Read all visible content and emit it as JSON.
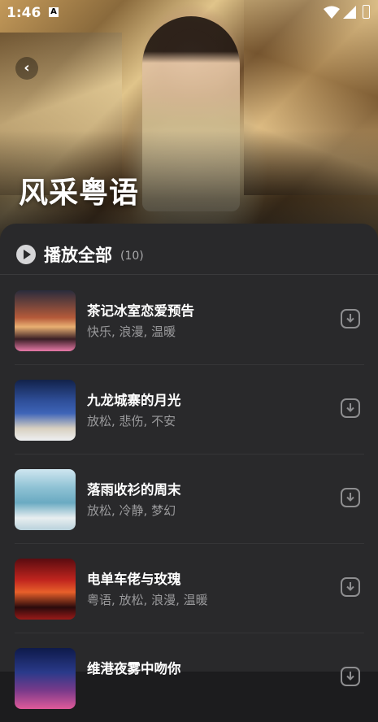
{
  "status_bar": {
    "time": "1:46",
    "notif_glyph": "A"
  },
  "header": {
    "title": "风采粤语",
    "back_icon": "chevron-left-icon"
  },
  "play_all": {
    "label": "播放全部",
    "count": "(10)"
  },
  "songs": [
    {
      "title": "茶记冰室恋爱预告",
      "tags": "快乐, 浪漫, 温暖"
    },
    {
      "title": "九龙城寨的月光",
      "tags": "放松, 悲伤, 不安"
    },
    {
      "title": "落雨收衫的周末",
      "tags": "放松, 冷静, 梦幻"
    },
    {
      "title": "电单车佬与玫瑰",
      "tags": "粤语, 放松, 浪漫, 温暖"
    },
    {
      "title": "维港夜雾中吻你",
      "tags": ""
    }
  ],
  "colors": {
    "sheet": "#29292b",
    "background": "#1c1c1e",
    "text": "#ffffff",
    "muted": "#9a9a9c"
  }
}
